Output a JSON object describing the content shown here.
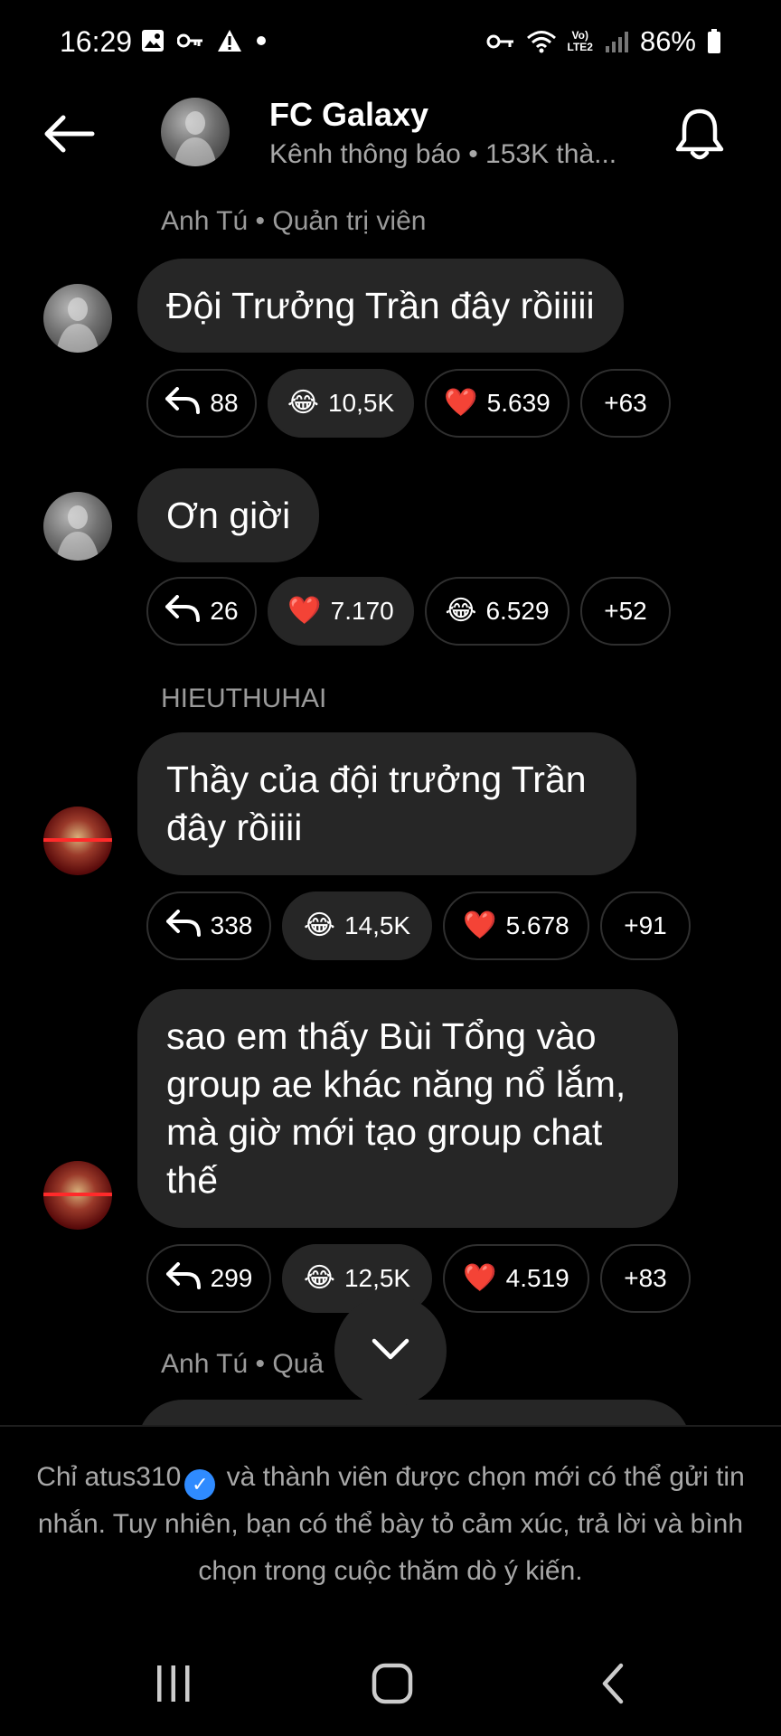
{
  "status_bar": {
    "time": "16:29",
    "left_icons": [
      "gallery-icon",
      "key-icon",
      "warning-icon",
      "dot-icon"
    ],
    "right_icons": [
      "vpn-key-icon",
      "wifi-icon",
      "volte-icon",
      "signal-icon"
    ],
    "volte_label": "Vo)\nLTE2",
    "battery_percent": "86%"
  },
  "header": {
    "title": "FC Galaxy",
    "subtitle": "Kênh thông báo • 153K thà..."
  },
  "messages": [
    {
      "sender": "Anh Tú • Quản trị viên",
      "text": "Đội Trưởng Trần đây rồiiiii",
      "reactions": [
        {
          "type": "reply",
          "icon": "reply-icon",
          "count": "88"
        },
        {
          "type": "emoji",
          "emoji": "😂",
          "icon": "laugh-icon",
          "count": "10,5K",
          "active": true
        },
        {
          "type": "emoji",
          "emoji": "❤️",
          "icon": "heart-icon",
          "count": "5.639"
        },
        {
          "type": "more",
          "count": "+63"
        }
      ]
    },
    {
      "text": "Ơn giời",
      "reactions": [
        {
          "type": "reply",
          "icon": "reply-icon",
          "count": "26"
        },
        {
          "type": "emoji",
          "emoji": "❤️",
          "icon": "heart-icon",
          "count": "7.170",
          "active": true
        },
        {
          "type": "emoji",
          "emoji": "😂",
          "icon": "laugh-icon",
          "count": "6.529"
        },
        {
          "type": "more",
          "count": "+52"
        }
      ]
    },
    {
      "sender": "HIEUTHUHAI",
      "text": "Thầy của đội trưởng Trần\nđây rồiiii",
      "reactions": [
        {
          "type": "reply",
          "icon": "reply-icon",
          "count": "338"
        },
        {
          "type": "emoji",
          "emoji": "😂",
          "icon": "laugh-icon",
          "count": "14,5K",
          "active": true
        },
        {
          "type": "emoji",
          "emoji": "❤️",
          "icon": "heart-icon",
          "count": "5.678"
        },
        {
          "type": "more",
          "count": "+91"
        }
      ]
    },
    {
      "text": "sao em thấy Bùi Tổng vào\ngroup ae khác năng nổ lắm,\nmà giờ mới tạo group chat\nthế",
      "reactions": [
        {
          "type": "reply",
          "icon": "reply-icon",
          "count": "299"
        },
        {
          "type": "emoji",
          "emoji": "😂",
          "icon": "laugh-icon",
          "count": "12,5K",
          "active": true
        },
        {
          "type": "emoji",
          "emoji": "❤️",
          "icon": "heart-icon",
          "count": "4.519"
        },
        {
          "type": "more",
          "count": "+83"
        }
      ]
    }
  ],
  "partial_sender": "Anh Tú • Quả",
  "footer": {
    "text_before": "Chỉ atus310",
    "text_after": " và thành viên được chọn mới có thể gửi tin nhắn. Tuy nhiên, bạn có thể bày tỏ cảm xúc, trả lời và bình chọn trong cuộc thăm dò ý kiến."
  },
  "icons": {
    "back": "back-arrow-icon",
    "bell": "bell-icon",
    "scroll_down": "chevron-down-icon",
    "verified": "verified-badge-icon",
    "nav_recents": "recents-icon",
    "nav_home": "home-icon",
    "nav_back": "nav-back-icon"
  },
  "colors": {
    "background": "#000000",
    "bubble": "#262626",
    "muted_text": "#a8a8a8",
    "verified": "#2f8bff"
  }
}
